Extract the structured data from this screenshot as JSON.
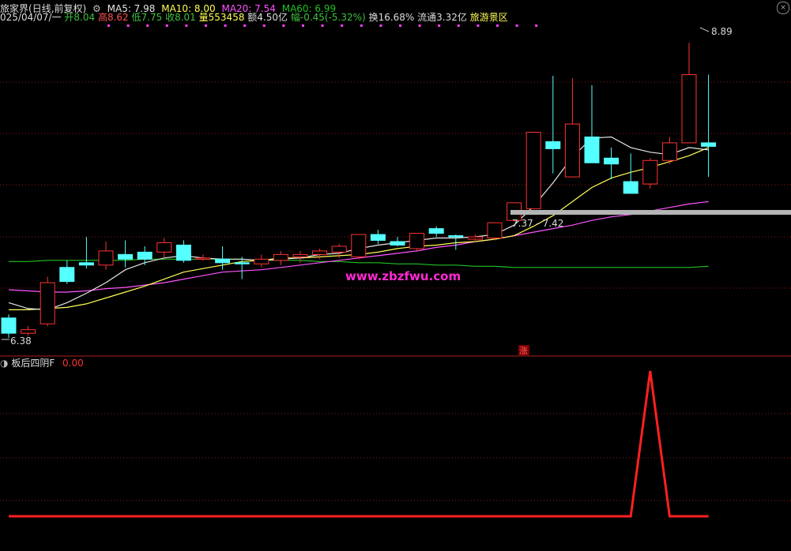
{
  "header": {
    "stock_name": "旅家界",
    "period": "(日线,前复权)",
    "ma5_label": "MA5: 7.98",
    "ma10_label": "MA10: 8.00",
    "ma20_label": "MA20: 7.54",
    "ma60_label": "MA60: 6.99",
    "date": "025/04/07/一",
    "open": "开8.04",
    "high": "高8.62",
    "low": "低7.75",
    "close": "收8.01",
    "volume": "量553458",
    "amount": "额4.50亿",
    "change": "幅-0.45(-5.32%)",
    "turnover": "换16.68%",
    "float_cap": "流通3.32亿",
    "sector": "旅游景区"
  },
  "colors": {
    "up": "#ff3232",
    "down": "#54ffff",
    "ma5": "#e6e6e6",
    "ma10": "#ffff54",
    "ma20": "#ff54ff",
    "ma60": "#22c022",
    "grid": "#8b1a1a",
    "indicator": "#ff2020"
  },
  "annotations": {
    "high_label": "8.89",
    "low_label": "6.38",
    "range_label": "7.37 - 7.42",
    "watermark": "www.zbzfwu.com",
    "limit_marker": "涨"
  },
  "indicator": {
    "name": "板后四阴F",
    "value": "0.00"
  },
  "chart_data": {
    "type": "candlestick",
    "ylim": [
      6.3,
      9.0
    ],
    "candles": [
      {
        "o": 6.55,
        "h": 6.58,
        "l": 6.38,
        "c": 6.42
      },
      {
        "o": 6.42,
        "h": 6.48,
        "l": 6.4,
        "c": 6.45
      },
      {
        "o": 6.5,
        "h": 6.9,
        "l": 6.48,
        "c": 6.85
      },
      {
        "o": 6.98,
        "h": 7.04,
        "l": 6.84,
        "c": 6.86
      },
      {
        "o": 7.02,
        "h": 7.24,
        "l": 6.97,
        "c": 7.0
      },
      {
        "o": 7.0,
        "h": 7.2,
        "l": 6.96,
        "c": 7.12
      },
      {
        "o": 7.09,
        "h": 7.21,
        "l": 6.98,
        "c": 7.05
      },
      {
        "o": 7.11,
        "h": 7.16,
        "l": 7.0,
        "c": 7.05
      },
      {
        "o": 7.11,
        "h": 7.23,
        "l": 7.06,
        "c": 7.19
      },
      {
        "o": 7.17,
        "h": 7.21,
        "l": 7.02,
        "c": 7.04
      },
      {
        "o": 7.05,
        "h": 7.09,
        "l": 7.04,
        "c": 7.06
      },
      {
        "o": 7.05,
        "h": 7.16,
        "l": 6.96,
        "c": 7.02
      },
      {
        "o": 7.02,
        "h": 7.07,
        "l": 6.88,
        "c": 7.01
      },
      {
        "o": 7.01,
        "h": 7.09,
        "l": 6.98,
        "c": 7.05
      },
      {
        "o": 7.04,
        "h": 7.12,
        "l": 7.0,
        "c": 7.09
      },
      {
        "o": 7.07,
        "h": 7.12,
        "l": 7.02,
        "c": 7.09
      },
      {
        "o": 7.09,
        "h": 7.14,
        "l": 7.05,
        "c": 7.12
      },
      {
        "o": 7.11,
        "h": 7.18,
        "l": 7.06,
        "c": 7.16
      },
      {
        "o": 7.07,
        "h": 7.26,
        "l": 7.05,
        "c": 7.26
      },
      {
        "o": 7.26,
        "h": 7.3,
        "l": 7.18,
        "c": 7.21
      },
      {
        "o": 7.2,
        "h": 7.24,
        "l": 7.16,
        "c": 7.17
      },
      {
        "o": 7.14,
        "h": 7.27,
        "l": 7.12,
        "c": 7.27
      },
      {
        "o": 7.31,
        "h": 7.33,
        "l": 7.24,
        "c": 7.27
      },
      {
        "o": 7.25,
        "h": 7.26,
        "l": 7.13,
        "c": 7.24
      },
      {
        "o": 7.22,
        "h": 7.26,
        "l": 7.2,
        "c": 7.24
      },
      {
        "o": 7.23,
        "h": 7.36,
        "l": 7.21,
        "c": 7.36
      },
      {
        "o": 7.38,
        "h": 7.53,
        "l": 7.37,
        "c": 7.53
      },
      {
        "o": 7.48,
        "h": 8.13,
        "l": 7.48,
        "c": 8.13
      },
      {
        "o": 8.05,
        "h": 8.61,
        "l": 7.78,
        "c": 7.99
      },
      {
        "o": 7.75,
        "h": 8.59,
        "l": 7.75,
        "c": 8.2
      },
      {
        "o": 8.09,
        "h": 8.53,
        "l": 7.87,
        "c": 7.87
      },
      {
        "o": 7.91,
        "h": 8.0,
        "l": 7.73,
        "c": 7.86
      },
      {
        "o": 7.71,
        "h": 7.95,
        "l": 7.62,
        "c": 7.61
      },
      {
        "o": 7.69,
        "h": 7.91,
        "l": 7.65,
        "c": 7.89
      },
      {
        "o": 7.89,
        "h": 8.09,
        "l": 7.86,
        "c": 8.04
      },
      {
        "o": 8.04,
        "h": 8.89,
        "l": 8.04,
        "c": 8.62
      },
      {
        "o": 8.04,
        "h": 8.62,
        "l": 7.75,
        "c": 8.01
      }
    ],
    "ma5": [
      6.68,
      6.63,
      6.62,
      6.68,
      6.76,
      6.85,
      6.96,
      7.02,
      7.06,
      7.08,
      7.06,
      7.05,
      7.05,
      7.04,
      7.05,
      7.06,
      7.09,
      7.1,
      7.14,
      7.17,
      7.19,
      7.21,
      7.23,
      7.23,
      7.24,
      7.26,
      7.34,
      7.5,
      7.7,
      7.92,
      8.08,
      8.09,
      8.0,
      7.96,
      7.94,
      8.0,
      7.98
    ],
    "ma10": [
      6.62,
      6.62,
      6.63,
      6.64,
      6.67,
      6.72,
      6.77,
      6.82,
      6.88,
      6.94,
      6.97,
      7.0,
      7.03,
      7.04,
      7.06,
      7.06,
      7.07,
      7.08,
      7.09,
      7.11,
      7.14,
      7.16,
      7.17,
      7.19,
      7.2,
      7.22,
      7.25,
      7.33,
      7.42,
      7.54,
      7.66,
      7.74,
      7.79,
      7.83,
      7.88,
      7.93,
      8.0
    ],
    "ma20": [
      6.79,
      6.78,
      6.77,
      6.77,
      6.78,
      6.8,
      6.81,
      6.83,
      6.85,
      6.88,
      6.91,
      6.94,
      6.95,
      6.96,
      6.98,
      7.0,
      7.02,
      7.04,
      7.06,
      7.08,
      7.1,
      7.12,
      7.15,
      7.17,
      7.2,
      7.22,
      7.25,
      7.28,
      7.31,
      7.34,
      7.38,
      7.41,
      7.43,
      7.46,
      7.49,
      7.52,
      7.54
    ],
    "ma60": [
      7.03,
      7.03,
      7.04,
      7.04,
      7.04,
      7.04,
      7.04,
      7.05,
      7.05,
      7.05,
      7.05,
      7.05,
      7.05,
      7.04,
      7.04,
      7.04,
      7.03,
      7.03,
      7.02,
      7.02,
      7.01,
      7.01,
      7.0,
      7.0,
      6.99,
      6.99,
      6.98,
      6.98,
      6.98,
      6.98,
      6.98,
      6.98,
      6.98,
      6.98,
      6.98,
      6.98,
      6.99
    ],
    "support_band": [
      7.37,
      7.42
    ],
    "indicator_values": [
      0,
      0,
      0,
      0,
      0,
      0,
      0,
      0,
      0,
      0,
      0,
      0,
      0,
      0,
      0,
      0,
      0,
      0,
      0,
      0,
      0,
      0,
      0,
      0,
      0,
      0,
      0,
      0,
      0,
      0,
      0,
      0,
      0,
      1,
      0,
      0,
      0
    ],
    "indicator_ylim": [
      -1,
      1
    ]
  }
}
